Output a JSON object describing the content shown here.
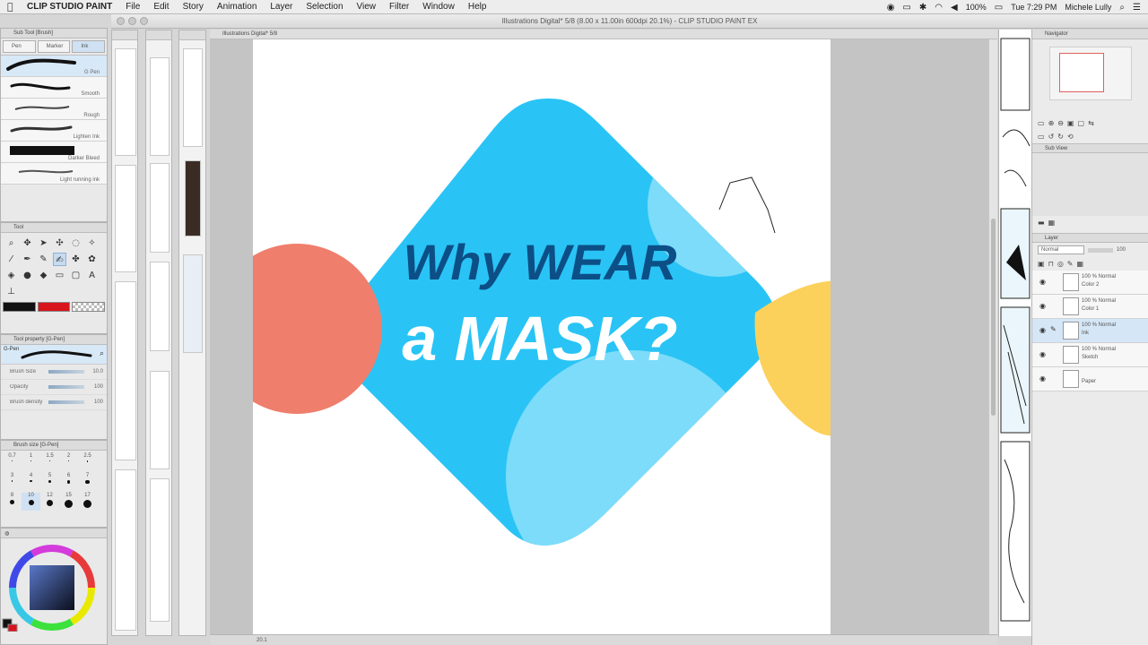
{
  "menubar": {
    "app_name": "CLIP STUDIO PAINT",
    "menus": [
      "File",
      "Edit",
      "Story",
      "Animation",
      "Layer",
      "Selection",
      "View",
      "Filter",
      "Window",
      "Help"
    ],
    "status": {
      "battery": "100%",
      "time": "Tue 7:29 PM",
      "user": "Michele Lully"
    }
  },
  "window": {
    "title": "Illustrations Digital* 5/8 (8.00 x 11.00in 600dpi 20.1%)  - CLIP STUDIO PAINT EX"
  },
  "left": {
    "subtool_header": "Sub Tool [Brush]",
    "subtool_tabs": [
      "Pen",
      "Marker",
      "Ink"
    ],
    "brushes": [
      "G Pen",
      "Smooth",
      "Rough",
      "Lighten Ink",
      "Darker Bleed",
      "Light running ink"
    ],
    "tool_header": "Tool",
    "tool_property_header": "Tool property [G-Pen]",
    "brush_name": "G-Pen",
    "properties": [
      {
        "label": "Brush Size",
        "value": "10.0"
      },
      {
        "label": "Opacity",
        "value": "100"
      },
      {
        "label": "Brush density",
        "value": "100"
      }
    ],
    "brush_size_header": "Brush size [G-Pen]",
    "brush_sizes": [
      "0.7",
      "1",
      "1.5",
      "2",
      "2.5",
      "3",
      "4",
      "5",
      "6",
      "7",
      "8",
      "10",
      "12",
      "15",
      "17"
    ],
    "color_swatches": {
      "main": "#111111",
      "sub": "#d8141c"
    }
  },
  "canvas": {
    "tab_label": "Illustrations Digital* 5/8",
    "zoom_readout": "20.1",
    "graphic": {
      "headline_line1": "Why WEAR",
      "headline_line2": "a MASK?",
      "colors": {
        "diamond": "#29c4f5",
        "diamond_highlight": "#7ddcfa",
        "circle": "#ef7e6d",
        "triangle": "#fbd15b",
        "headline_dark": "#0c4f86",
        "headline_light": "#ffffff"
      }
    }
  },
  "right": {
    "navigator_header": "Navigator",
    "subview_tab": "Sub View",
    "layer_header": "Layer",
    "blend_mode": "Normal",
    "opacity": "100",
    "layers": [
      {
        "pct": "100 % Normal",
        "name": "Color 2"
      },
      {
        "pct": "100 % Normal",
        "name": "Color 1"
      },
      {
        "pct": "100 % Normal",
        "name": "Ink"
      },
      {
        "pct": "100 % Normal",
        "name": "Sketch"
      },
      {
        "pct": "",
        "name": "Paper"
      }
    ]
  }
}
